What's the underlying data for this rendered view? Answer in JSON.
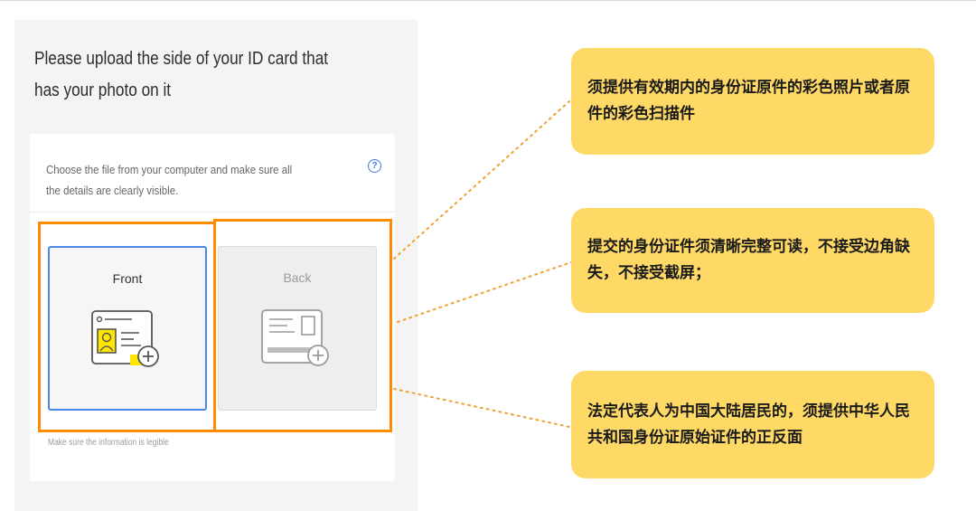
{
  "upload": {
    "heading": "Please upload the side of your ID card that has your photo on it",
    "instruction": "Choose the file from your computer and make sure all the details are clearly visible.",
    "help_icon": "question-circle-icon",
    "front_label": "Front",
    "back_label": "Back",
    "hint": "Make sure the information is legible"
  },
  "notes": [
    "须提供有效期内的身份证原件的彩色照片或者原件的彩色扫描件",
    "提交的身份证件须清晰完整可读，不接受边角缺失，不接受截屏；",
    "法定代表人为中国大陆居民的，须提供中华人民共和国身份证原始证件的正反面"
  ],
  "colors": {
    "highlight": "#ff8c00",
    "note_background": "#ffd966",
    "selected_border": "#4a88ea",
    "accent_yellow": "#ffe600",
    "help_blue": "#3d7be3"
  }
}
